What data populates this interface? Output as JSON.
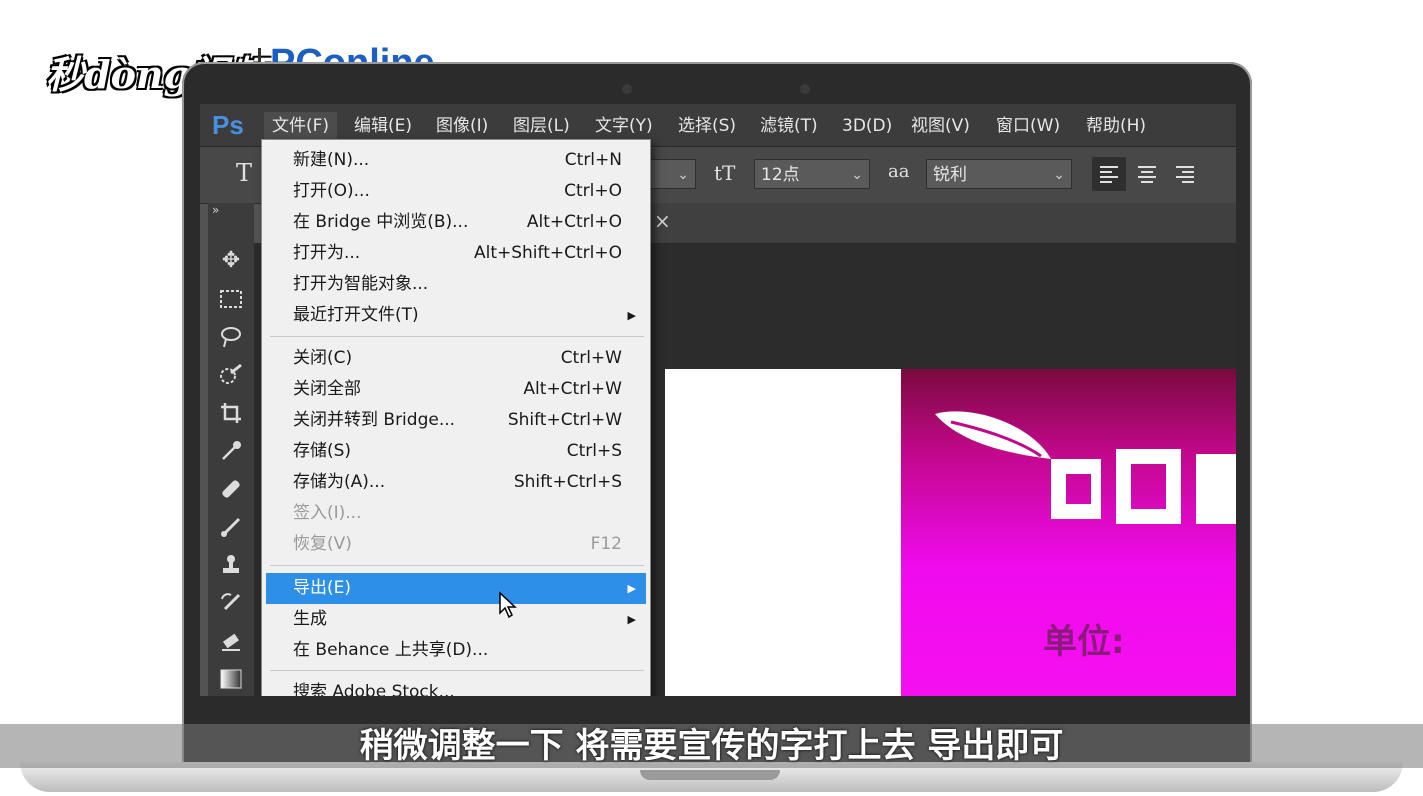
{
  "watermark": {
    "brand1": "秒dòng视频",
    "brand2": "PConline"
  },
  "app": {
    "logo": "Ps"
  },
  "menubar": {
    "items": [
      "文件(F)",
      "编辑(E)",
      "图像(I)",
      "图层(L)",
      "文字(Y)",
      "选择(S)",
      "滤镜(T)",
      "3D(D)",
      "视图(V)",
      "窗口(W)",
      "帮助(H)"
    ]
  },
  "options": {
    "tool_glyph": "T",
    "size_icon": "tT",
    "font_size": "12点",
    "aa_icon": "aa",
    "antialias": "锐利"
  },
  "tab": {
    "close_glyph": "×"
  },
  "file_menu": {
    "items": [
      {
        "label": "新建(N)...",
        "shortcut": "Ctrl+N"
      },
      {
        "label": "打开(O)...",
        "shortcut": "Ctrl+O"
      },
      {
        "label": "在 Bridge 中浏览(B)...",
        "shortcut": "Alt+Ctrl+O"
      },
      {
        "label": "打开为...",
        "shortcut": "Alt+Shift+Ctrl+O"
      },
      {
        "label": "打开为智能对象...",
        "shortcut": ""
      },
      {
        "label": "最近打开文件(T)",
        "shortcut": ""
      },
      {
        "label": "关闭(C)",
        "shortcut": "Ctrl+W"
      },
      {
        "label": "关闭全部",
        "shortcut": "Alt+Ctrl+W"
      },
      {
        "label": "关闭并转到 Bridge...",
        "shortcut": "Shift+Ctrl+W"
      },
      {
        "label": "存储(S)",
        "shortcut": "Ctrl+S"
      },
      {
        "label": "存储为(A)...",
        "shortcut": "Shift+Ctrl+S"
      },
      {
        "label": "签入(I)...",
        "shortcut": ""
      },
      {
        "label": "恢复(V)",
        "shortcut": "F12"
      },
      {
        "label": "导出(E)",
        "shortcut": ""
      },
      {
        "label": "生成",
        "shortcut": ""
      },
      {
        "label": "在 Behance 上共享(D)...",
        "shortcut": ""
      },
      {
        "label": "搜索 Adobe Stock...",
        "shortcut": ""
      }
    ]
  },
  "document": {
    "unit_label": "单位:"
  },
  "subtitle": "稍微调整一下 将需要宣传的字打上去 导出即可",
  "colors": {
    "highlight": "#2e8fe8",
    "ps_blue": "#4a90e2",
    "poster_pink": "#f00aee"
  }
}
